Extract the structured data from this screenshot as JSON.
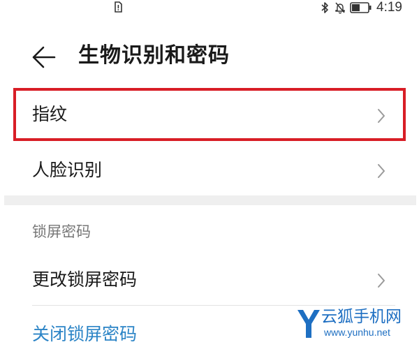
{
  "status_bar": {
    "time": "4:19",
    "left_icon": "sim-alert-icon",
    "right_icons": [
      "bluetooth-icon",
      "bell-off-icon",
      "battery-icon"
    ]
  },
  "header": {
    "title": "生物识别和密码",
    "back_icon": "back-arrow-icon"
  },
  "biometrics": {
    "items": [
      {
        "label": "指纹",
        "highlighted": true
      },
      {
        "label": "人脸识别",
        "highlighted": false
      }
    ]
  },
  "lock_screen": {
    "section_title": "锁屏密码",
    "change_label": "更改锁屏密码",
    "close_label": "关闭锁屏密码"
  },
  "colors": {
    "highlight": "#d81e26",
    "link": "#2b84c6",
    "divider": "#efefef",
    "watermark": "#1e6fc2"
  },
  "watermark": {
    "name": "云狐手机网",
    "url": "www.yunhu.net"
  }
}
